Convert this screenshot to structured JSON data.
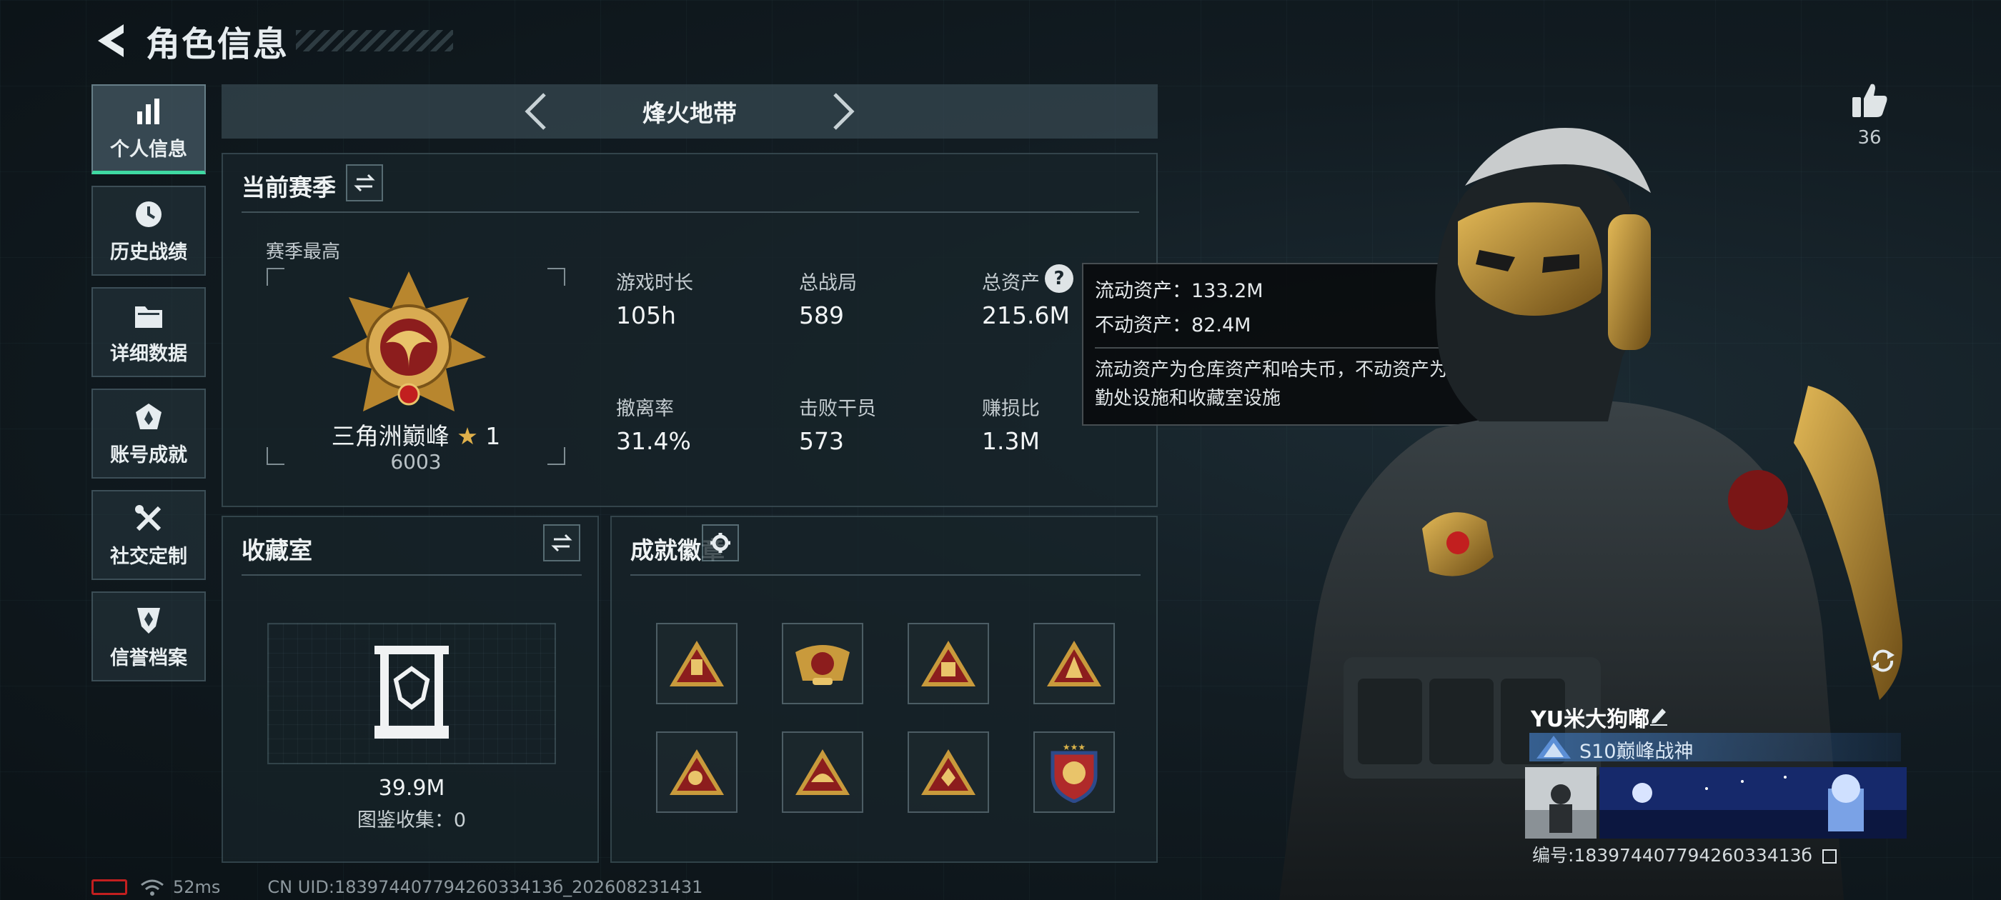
{
  "header": {
    "title": "角色信息"
  },
  "sidebar": {
    "items": [
      {
        "label": "个人信息",
        "icon": "bar-chart-icon",
        "active": true
      },
      {
        "label": "历史战绩",
        "icon": "clock-icon"
      },
      {
        "label": "详细数据",
        "icon": "folder-icon"
      },
      {
        "label": "账号成就",
        "icon": "achievement-icon"
      },
      {
        "label": "社交定制",
        "icon": "tools-icon"
      },
      {
        "label": "信誉档案",
        "icon": "shield-icon"
      }
    ]
  },
  "mode_bar": {
    "label": "烽火地带"
  },
  "season": {
    "title": "当前赛季",
    "highest_label": "赛季最高",
    "rank_name": "三角洲巅峰",
    "rank_stars": "1",
    "rank_score": "6003",
    "stats": [
      {
        "label": "游戏时长",
        "value": "105h"
      },
      {
        "label": "总战局",
        "value": "589"
      },
      {
        "label": "总资产",
        "value": "215.6M"
      },
      {
        "label": "撤离率",
        "value": "31.4%"
      },
      {
        "label": "击败干员",
        "value": "573"
      },
      {
        "label": "赚损比",
        "value": "1.3M"
      }
    ]
  },
  "tooltip": {
    "liquid": "流动资产：133.2M",
    "fixed": "不动资产：82.4M",
    "desc": "流动资产为仓库资产和哈夫币，不动资产为特勤处设施和收藏室设施"
  },
  "collection": {
    "title": "收藏室",
    "value": "39.9M",
    "catalog": "图鉴收集：0"
  },
  "achievements": {
    "title": "成就徽章",
    "badges": [
      "badge-1",
      "badge-2",
      "badge-3",
      "badge-4",
      "badge-5",
      "badge-6",
      "badge-7",
      "badge-8"
    ]
  },
  "like": {
    "count": "36"
  },
  "profile": {
    "name": "YU米大狗嘟",
    "title": "S10巅峰战神",
    "id_text": "编号:18397440779426033413б"
  },
  "status": {
    "ping": "52ms",
    "uid": "CN UID:18397440779426033413б_202608231431"
  },
  "colors": {
    "accent": "#3fd9a2",
    "gold": "#c99a3c",
    "badge_red": "#8c1d1d"
  }
}
